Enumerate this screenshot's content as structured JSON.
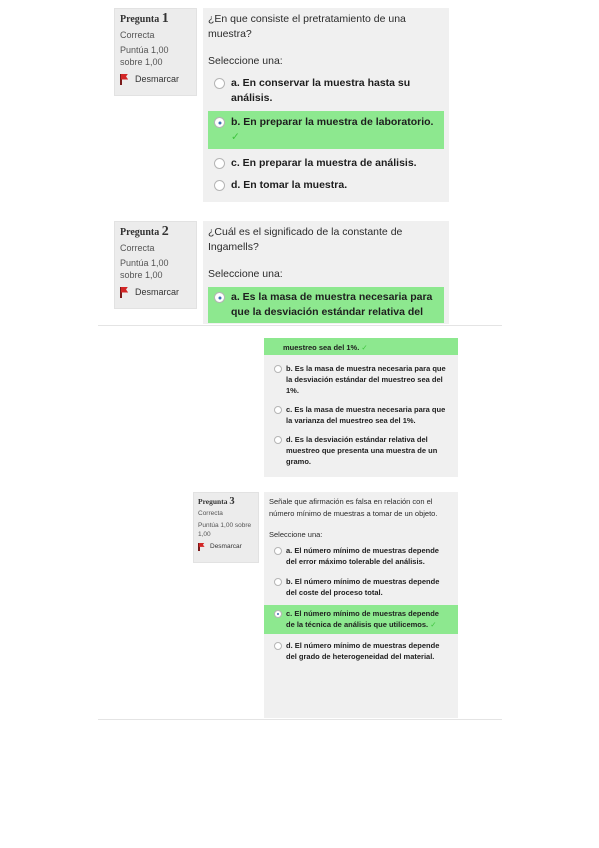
{
  "q1": {
    "label": "Pregunta",
    "number": "1",
    "state": "Correcta",
    "grade": "Puntúa 1,00 sobre 1,00",
    "flag_label": "Desmarcar",
    "question": "¿En que consiste el pretratamiento de una muestra?",
    "prompt": "Seleccione una:",
    "answers": [
      "a. En conservar la muestra hasta su análisis.",
      "b. En preparar la muestra de laboratorio.",
      "c. En preparar la muestra de análisis.",
      "d. En tomar la muestra."
    ],
    "selected_index": 1,
    "correct_index": 1
  },
  "q2": {
    "label": "Pregunta",
    "number": "2",
    "state": "Correcta",
    "grade": "Puntúa 1,00 sobre 1,00",
    "flag_label": "Desmarcar",
    "question": "¿Cuál es el significado de la constante de Ingamells?",
    "prompt": "Seleccione una:",
    "answer_a_top": "a. Es la masa de muestra necesaria para que la desviación estándar relativa del",
    "answer_a_bottom": "muestreo sea del 1%.",
    "answers_rest": [
      "b. Es la masa de muestra necesaria para que la desviación estándar del muestreo sea del 1%.",
      "c. Es la masa de muestra necesaria para que la varianza del muestreo sea del 1%.",
      "d. Es la desviación estándar relativa del muestreo que presenta una muestra de un gramo."
    ],
    "selected_index": 0,
    "correct_index": 0
  },
  "q3": {
    "label": "Pregunta",
    "number": "3",
    "state": "Correcta",
    "grade": "Puntúa 1,00 sobre 1,00",
    "flag_label": "Desmarcar",
    "question": "Señale que afirmación es falsa en relación con el número mínimo de muestras a tomar de un objeto.",
    "prompt": "Seleccione una:",
    "answers": [
      "a. El número mínimo de muestras depende del error máximo tolerable del análisis.",
      "b. El número mínimo de muestras depende del coste del proceso total.",
      "c. El número mínimo de muestras depende de la técnica de análisis que utilicemos.",
      "d. El número mínimo de muestras depende del grado de heterogeneidad del material."
    ],
    "selected_index": 2,
    "correct_index": 2
  },
  "colors": {
    "correct_bg": "#8de88f",
    "check": "#3ec43e",
    "flag": "#d32626",
    "info_bg": "#ececec",
    "content_bg": "#f0f0f0"
  },
  "icons": [
    "flag-icon",
    "check-icon",
    "radio-icon"
  ]
}
